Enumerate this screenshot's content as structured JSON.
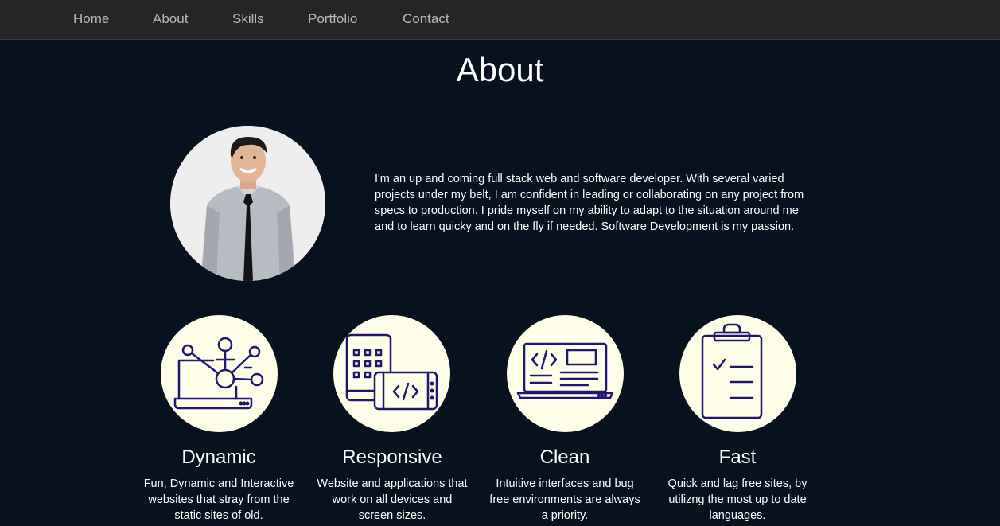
{
  "nav": {
    "links": [
      "Home",
      "About",
      "Skills",
      "Portfolio",
      "Contact"
    ]
  },
  "about": {
    "title": "About",
    "bio": "I'm an up and coming full stack web and software developer. With several varied projects under my belt, I am confident in leading or collaborating on any project from specs to production. I pride myself on my ability to adapt to the situation around me and to learn quicky and on the fly if needed. Software Development is my passion."
  },
  "features": [
    {
      "icon": "laptop-network-icon",
      "title": "Dynamic",
      "description": "Fun, Dynamic and Interactive websites that stray from the static sites of old."
    },
    {
      "icon": "responsive-devices-icon",
      "title": "Responsive",
      "description": "Website and applications that work on all devices and screen sizes."
    },
    {
      "icon": "laptop-code-icon",
      "title": "Clean",
      "description": "Intuitive interfaces and bug free environments are always a priority."
    },
    {
      "icon": "clipboard-checklist-icon",
      "title": "Fast",
      "description": "Quick and lag free sites, by utilizng the most up to date languages."
    }
  ],
  "colors": {
    "background": "#08111e",
    "navbar": "#252525",
    "nav_text": "#b9b9b9",
    "icon_circle": "#fdfde8",
    "icon_stroke": "#1e1670"
  }
}
